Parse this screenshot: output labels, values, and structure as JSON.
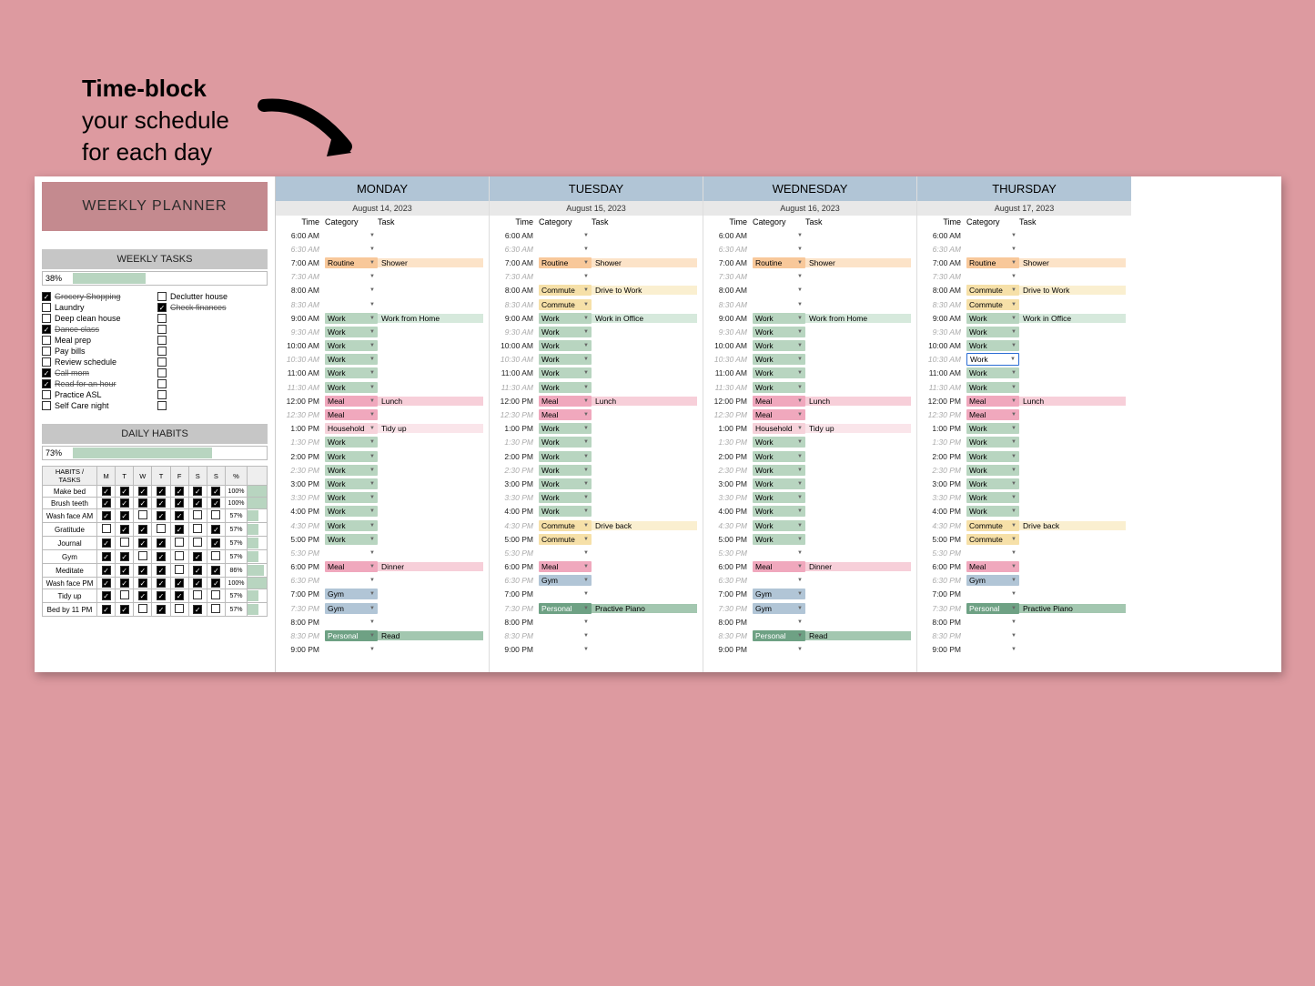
{
  "annotation": {
    "bold": "Time-block",
    "line2": "your schedule",
    "line3": "for each day"
  },
  "sidebar": {
    "title": "WEEKLY PLANNER",
    "tasks_header": "WEEKLY TASKS",
    "tasks_pct": "38%",
    "tasks_fill": 38,
    "tasks": [
      {
        "label": "Grocery Shopping",
        "checked": true,
        "strike": true
      },
      {
        "label": "Declutter house",
        "checked": false
      },
      {
        "label": "Laundry",
        "checked": false
      },
      {
        "label": "Check finances",
        "checked": true,
        "strike": true
      },
      {
        "label": "Deep clean house",
        "checked": false
      },
      {
        "label": "",
        "checked": false,
        "empty": true
      },
      {
        "label": "Dance class",
        "checked": true,
        "strike": true
      },
      {
        "label": "",
        "checked": false,
        "empty": true
      },
      {
        "label": "Meal prep",
        "checked": false
      },
      {
        "label": "",
        "checked": false,
        "empty": true
      },
      {
        "label": "Pay bills",
        "checked": false
      },
      {
        "label": "",
        "checked": false,
        "empty": true
      },
      {
        "label": "Review schedule",
        "checked": false
      },
      {
        "label": "",
        "checked": false,
        "empty": true
      },
      {
        "label": "Call mom",
        "checked": true,
        "strike": true
      },
      {
        "label": "",
        "checked": false,
        "empty": true
      },
      {
        "label": "Read for an hour",
        "checked": true,
        "strike": true
      },
      {
        "label": "",
        "checked": false,
        "empty": true
      },
      {
        "label": "Practice ASL",
        "checked": false
      },
      {
        "label": "",
        "checked": false,
        "empty": true
      },
      {
        "label": "Self Care night",
        "checked": false
      },
      {
        "label": "",
        "checked": false,
        "empty": true
      }
    ],
    "habits_header": "DAILY HABITS",
    "habits_pct": "73%",
    "habits_fill": 73,
    "habits_cols": [
      "HABITS / TASKS",
      "M",
      "T",
      "W",
      "T",
      "F",
      "S",
      "S",
      "%"
    ],
    "habits": [
      {
        "name": "Make bed",
        "d": [
          1,
          1,
          1,
          1,
          1,
          1,
          1
        ],
        "pct": "100%",
        "bar": 100
      },
      {
        "name": "Brush teeth",
        "d": [
          1,
          1,
          1,
          1,
          1,
          1,
          1
        ],
        "pct": "100%",
        "bar": 100
      },
      {
        "name": "Wash face AM",
        "d": [
          1,
          1,
          0,
          1,
          1,
          0,
          0
        ],
        "pct": "57%",
        "bar": 57
      },
      {
        "name": "Gratitude",
        "d": [
          0,
          1,
          1,
          0,
          1,
          0,
          1
        ],
        "pct": "57%",
        "bar": 57
      },
      {
        "name": "Journal",
        "d": [
          1,
          0,
          1,
          1,
          0,
          0,
          1
        ],
        "pct": "57%",
        "bar": 57
      },
      {
        "name": "Gym",
        "d": [
          1,
          1,
          0,
          1,
          0,
          1,
          0
        ],
        "pct": "57%",
        "bar": 57
      },
      {
        "name": "Meditate",
        "d": [
          1,
          1,
          1,
          1,
          0,
          1,
          1
        ],
        "pct": "86%",
        "bar": 86
      },
      {
        "name": "Wash face PM",
        "d": [
          1,
          1,
          1,
          1,
          1,
          1,
          1
        ],
        "pct": "100%",
        "bar": 100
      },
      {
        "name": "Tidy up",
        "d": [
          1,
          0,
          1,
          1,
          1,
          0,
          0
        ],
        "pct": "57%",
        "bar": 57
      },
      {
        "name": "Bed by 11 PM",
        "d": [
          1,
          1,
          0,
          1,
          0,
          1,
          0
        ],
        "pct": "57%",
        "bar": 57
      }
    ]
  },
  "col_labels": {
    "time": "Time",
    "category": "Category",
    "task": "Task"
  },
  "times": [
    "6:00 AM",
    "6:30 AM",
    "7:00 AM",
    "7:30 AM",
    "8:00 AM",
    "8:30 AM",
    "9:00 AM",
    "9:30 AM",
    "10:00 AM",
    "10:30 AM",
    "11:00 AM",
    "11:30 AM",
    "12:00 PM",
    "12:30 PM",
    "1:00 PM",
    "1:30 PM",
    "2:00 PM",
    "2:30 PM",
    "3:00 PM",
    "3:30 PM",
    "4:00 PM",
    "4:30 PM",
    "5:00 PM",
    "5:30 PM",
    "6:00 PM",
    "6:30 PM",
    "7:00 PM",
    "7:30 PM",
    "8:00 PM",
    "8:30 PM",
    "9:00 PM"
  ],
  "days": [
    {
      "name": "MONDAY",
      "date": "August 14, 2023",
      "slots": [
        null,
        null,
        {
          "cat": "Routine",
          "task": "Shower",
          "c": "routine"
        },
        null,
        null,
        null,
        {
          "cat": "Work",
          "task": "Work from Home",
          "c": "work"
        },
        {
          "cat": "Work",
          "c": "work",
          "half": true
        },
        {
          "cat": "Work",
          "c": "work"
        },
        {
          "cat": "Work",
          "c": "work",
          "half": true
        },
        {
          "cat": "Work",
          "c": "work"
        },
        {
          "cat": "Work",
          "c": "work",
          "half": true
        },
        {
          "cat": "Meal",
          "task": "Lunch",
          "c": "meal"
        },
        {
          "cat": "Meal",
          "c": "meal",
          "half": true
        },
        {
          "cat": "Household",
          "task": "Tidy up",
          "c": "household"
        },
        {
          "cat": "Work",
          "c": "work",
          "half": true
        },
        {
          "cat": "Work",
          "c": "work"
        },
        {
          "cat": "Work",
          "c": "work",
          "half": true
        },
        {
          "cat": "Work",
          "c": "work"
        },
        {
          "cat": "Work",
          "c": "work",
          "half": true
        },
        {
          "cat": "Work",
          "c": "work"
        },
        {
          "cat": "Work",
          "c": "work",
          "half": true
        },
        {
          "cat": "Work",
          "c": "work"
        },
        null,
        {
          "cat": "Meal",
          "task": "Dinner",
          "c": "meal"
        },
        null,
        {
          "cat": "Gym",
          "c": "gym"
        },
        {
          "cat": "Gym",
          "c": "gym",
          "half": true
        },
        null,
        {
          "cat": "Personal",
          "task": "Read",
          "c": "personal"
        },
        null
      ]
    },
    {
      "name": "TUESDAY",
      "date": "August 15, 2023",
      "slots": [
        null,
        null,
        {
          "cat": "Routine",
          "task": "Shower",
          "c": "routine"
        },
        null,
        {
          "cat": "Commute",
          "task": "Drive to Work",
          "c": "commute"
        },
        {
          "cat": "Commute",
          "c": "commute",
          "half": true
        },
        {
          "cat": "Work",
          "task": "Work in Office",
          "c": "work"
        },
        {
          "cat": "Work",
          "c": "work",
          "half": true
        },
        {
          "cat": "Work",
          "c": "work"
        },
        {
          "cat": "Work",
          "c": "work",
          "half": true
        },
        {
          "cat": "Work",
          "c": "work"
        },
        {
          "cat": "Work",
          "c": "work",
          "half": true
        },
        {
          "cat": "Meal",
          "task": "Lunch",
          "c": "meal"
        },
        {
          "cat": "Meal",
          "c": "meal",
          "half": true
        },
        {
          "cat": "Work",
          "c": "work"
        },
        {
          "cat": "Work",
          "c": "work",
          "half": true
        },
        {
          "cat": "Work",
          "c": "work"
        },
        {
          "cat": "Work",
          "c": "work",
          "half": true
        },
        {
          "cat": "Work",
          "c": "work"
        },
        {
          "cat": "Work",
          "c": "work",
          "half": true
        },
        {
          "cat": "Work",
          "c": "work"
        },
        {
          "cat": "Commute",
          "task": "Drive back",
          "c": "commute",
          "half": true
        },
        {
          "cat": "Commute",
          "c": "commute"
        },
        null,
        {
          "cat": "Meal",
          "c": "meal"
        },
        {
          "cat": "Gym",
          "c": "gym",
          "half": true
        },
        null,
        {
          "cat": "Personal",
          "task": "Practive Piano",
          "c": "personal",
          "half": true
        },
        null,
        null,
        null
      ]
    },
    {
      "name": "WEDNESDAY",
      "date": "August 16, 2023",
      "slots": [
        null,
        null,
        {
          "cat": "Routine",
          "task": "Shower",
          "c": "routine"
        },
        null,
        null,
        null,
        {
          "cat": "Work",
          "task": "Work from Home",
          "c": "work"
        },
        {
          "cat": "Work",
          "c": "work",
          "half": true
        },
        {
          "cat": "Work",
          "c": "work"
        },
        {
          "cat": "Work",
          "c": "work",
          "half": true
        },
        {
          "cat": "Work",
          "c": "work"
        },
        {
          "cat": "Work",
          "c": "work",
          "half": true
        },
        {
          "cat": "Meal",
          "task": "Lunch",
          "c": "meal"
        },
        {
          "cat": "Meal",
          "c": "meal",
          "half": true
        },
        {
          "cat": "Household",
          "task": "Tidy up",
          "c": "household"
        },
        {
          "cat": "Work",
          "c": "work",
          "half": true
        },
        {
          "cat": "Work",
          "c": "work"
        },
        {
          "cat": "Work",
          "c": "work",
          "half": true
        },
        {
          "cat": "Work",
          "c": "work"
        },
        {
          "cat": "Work",
          "c": "work",
          "half": true
        },
        {
          "cat": "Work",
          "c": "work"
        },
        {
          "cat": "Work",
          "c": "work",
          "half": true
        },
        {
          "cat": "Work",
          "c": "work"
        },
        null,
        {
          "cat": "Meal",
          "task": "Dinner",
          "c": "meal"
        },
        null,
        {
          "cat": "Gym",
          "c": "gym"
        },
        {
          "cat": "Gym",
          "c": "gym",
          "half": true
        },
        null,
        {
          "cat": "Personal",
          "task": "Read",
          "c": "personal"
        },
        null
      ]
    },
    {
      "name": "THURSDAY",
      "date": "August 17, 2023",
      "slots": [
        null,
        null,
        {
          "cat": "Routine",
          "task": "Shower",
          "c": "routine"
        },
        null,
        {
          "cat": "Commute",
          "task": "Drive to Work",
          "c": "commute"
        },
        {
          "cat": "Commute",
          "c": "commute",
          "half": true
        },
        {
          "cat": "Work",
          "task": "Work in Office",
          "c": "work"
        },
        {
          "cat": "Work",
          "c": "work",
          "half": true
        },
        {
          "cat": "Work",
          "c": "work"
        },
        {
          "cat": "Work",
          "c": "work-sel",
          "half": true
        },
        {
          "cat": "Work",
          "c": "work"
        },
        {
          "cat": "Work",
          "c": "work",
          "half": true
        },
        {
          "cat": "Meal",
          "task": "Lunch",
          "c": "meal"
        },
        {
          "cat": "Meal",
          "c": "meal",
          "half": true
        },
        {
          "cat": "Work",
          "c": "work"
        },
        {
          "cat": "Work",
          "c": "work",
          "half": true
        },
        {
          "cat": "Work",
          "c": "work"
        },
        {
          "cat": "Work",
          "c": "work",
          "half": true
        },
        {
          "cat": "Work",
          "c": "work"
        },
        {
          "cat": "Work",
          "c": "work",
          "half": true
        },
        {
          "cat": "Work",
          "c": "work"
        },
        {
          "cat": "Commute",
          "task": "Drive back",
          "c": "commute",
          "half": true
        },
        {
          "cat": "Commute",
          "c": "commute"
        },
        null,
        {
          "cat": "Meal",
          "c": "meal"
        },
        {
          "cat": "Gym",
          "c": "gym",
          "half": true
        },
        null,
        {
          "cat": "Personal",
          "task": "Practive Piano",
          "c": "personal",
          "half": true
        },
        null,
        null,
        null
      ]
    }
  ]
}
